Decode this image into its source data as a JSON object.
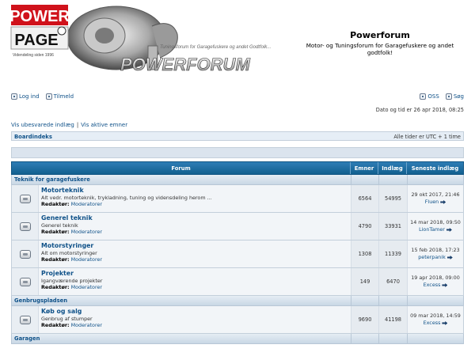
{
  "header": {
    "logo_power": "POWER",
    "logo_page": "PAGE",
    "logo_since": "Videndeling siden 1996",
    "logo_tagline": "Tuningsforum for Garagefuskere og andet Godtfolk...",
    "logo_forum": "POWERFORUM",
    "site_title": "Powerforum",
    "site_desc": "Motor- og Tuningsforum for Garagefuskere og andet godtfolk!"
  },
  "nav": {
    "login": "Log ind",
    "register": "Tilmeld",
    "faq": "OSS",
    "search": "Søg"
  },
  "datetime": "Dato og tid er 26 apr 2018, 08:25",
  "links": {
    "unread": "Vis ubesvarede indlæg",
    "sep": "|",
    "active": "Vis aktive emner"
  },
  "breadcrumb": {
    "index": "Boardindeks",
    "timezone": "Alle tider er UTC + 1 time"
  },
  "table": {
    "headers": {
      "forum": "Forum",
      "topics": "Emner",
      "posts": "Indlæg",
      "last": "Seneste indlæg"
    },
    "moderator_label": "Redaktør:",
    "categories": [
      {
        "name": "Teknik for garagefuskere",
        "forums": [
          {
            "name": "Motorteknik",
            "desc": "Alt vedr. motorteknik, trykladning, tuning og vidensdeling herom ...",
            "mod": "Moderatorer",
            "topics": "6564",
            "posts": "54995",
            "last_date": "29 okt 2017, 21:46",
            "last_user": "Fluen"
          },
          {
            "name": "Generel teknik",
            "desc": "Generel teknik",
            "mod": "Moderatorer",
            "topics": "4790",
            "posts": "33931",
            "last_date": "14 mar 2018, 09:50",
            "last_user": "LionTamer"
          },
          {
            "name": "Motorstyringer",
            "desc": "Alt om motorstyringer",
            "mod": "Moderatorer",
            "topics": "1308",
            "posts": "11339",
            "last_date": "15 feb 2018, 17:23",
            "last_user": "peterpanik"
          },
          {
            "name": "Projekter",
            "desc": "Igangværende projekter",
            "mod": "Moderatorer",
            "topics": "149",
            "posts": "6470",
            "last_date": "19 apr 2018, 09:00",
            "last_user": "Excess"
          }
        ]
      },
      {
        "name": "Genbrugspladsen",
        "forums": [
          {
            "name": "Køb og salg",
            "desc": "Genbrug af stumper",
            "mod": "Moderatorer",
            "topics": "9690",
            "posts": "41198",
            "last_date": "09 mar 2018, 14:59",
            "last_user": "Excess"
          }
        ]
      },
      {
        "name": "Garagen",
        "forums": []
      }
    ]
  },
  "colors": {
    "link": "#105289",
    "header_blue": "#12608f",
    "logo_red": "#d0121b"
  }
}
